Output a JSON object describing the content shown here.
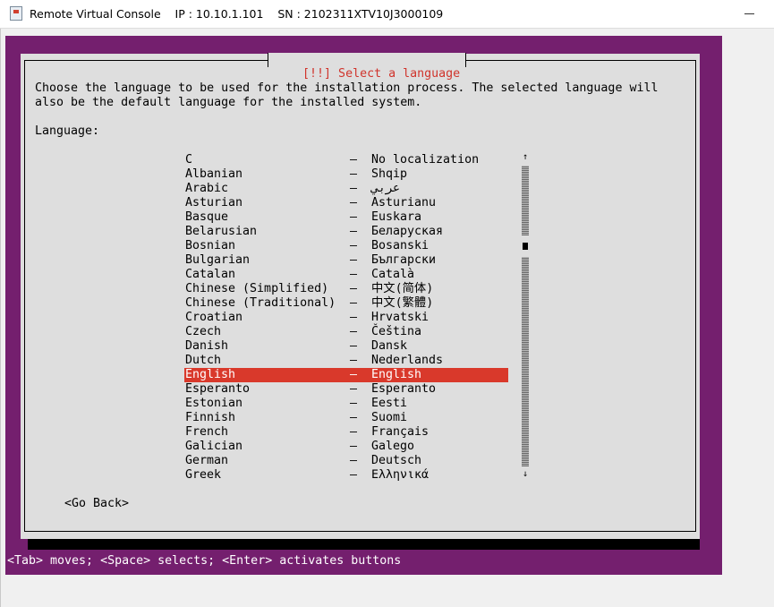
{
  "window": {
    "title": "Remote Virtual Console    IP : 10.10.1.101    SN : 2102311XTV10J3000109"
  },
  "dialog": {
    "title": "[!!] Select a language",
    "description": "Choose the language to be used for the installation process. The selected language will\nalso be the default language for the installed system.",
    "list_label": "Language:",
    "languages": [
      {
        "name": "C",
        "native": "No localization"
      },
      {
        "name": "Albanian",
        "native": "Shqip"
      },
      {
        "name": "Arabic",
        "native": "عربي"
      },
      {
        "name": "Asturian",
        "native": "Asturianu"
      },
      {
        "name": "Basque",
        "native": "Euskara"
      },
      {
        "name": "Belarusian",
        "native": "Беларуская"
      },
      {
        "name": "Bosnian",
        "native": "Bosanski"
      },
      {
        "name": "Bulgarian",
        "native": "Български"
      },
      {
        "name": "Catalan",
        "native": "Català"
      },
      {
        "name": "Chinese (Simplified)",
        "native": "中文(简体)"
      },
      {
        "name": "Chinese (Traditional)",
        "native": "中文(繁體)"
      },
      {
        "name": "Croatian",
        "native": "Hrvatski"
      },
      {
        "name": "Czech",
        "native": "Čeština"
      },
      {
        "name": "Danish",
        "native": "Dansk"
      },
      {
        "name": "Dutch",
        "native": "Nederlands"
      },
      {
        "name": "English",
        "native": "English",
        "selected": true
      },
      {
        "name": "Esperanto",
        "native": "Esperanto"
      },
      {
        "name": "Estonian",
        "native": "Eesti"
      },
      {
        "name": "Finnish",
        "native": "Suomi"
      },
      {
        "name": "French",
        "native": "Français"
      },
      {
        "name": "Galician",
        "native": "Galego"
      },
      {
        "name": "German",
        "native": "Deutsch"
      },
      {
        "name": "Greek",
        "native": "Ελληνικά"
      }
    ],
    "separator": "–",
    "go_back_label": "<Go Back>",
    "scroll_up_glyph": "↑",
    "scroll_down_glyph": "↓"
  },
  "status_bar": {
    "text": "<Tab> moves; <Space> selects; <Enter> activates buttons"
  },
  "colors": {
    "console_background": "#741f6e",
    "dialog_background": "#dedede",
    "title_color": "#d0342c",
    "selection_background": "#d9392b"
  }
}
